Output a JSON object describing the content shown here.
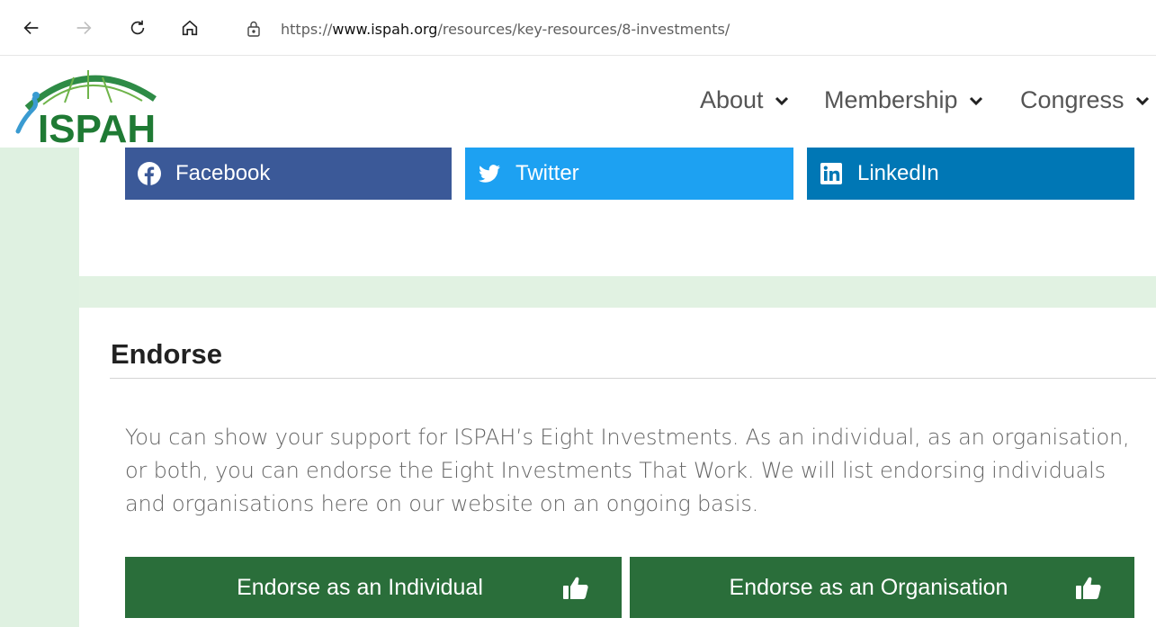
{
  "browser": {
    "url_prefix": "https://",
    "url_host": "www.ispah.org",
    "url_path": "/resources/key-resources/8-investments/"
  },
  "header": {
    "logo_text": "ISPAH",
    "menu": [
      {
        "label": "About"
      },
      {
        "label": "Membership"
      },
      {
        "label": "Congress"
      }
    ]
  },
  "share": {
    "facebook": "Facebook",
    "twitter": "Twitter",
    "linkedin": "LinkedIn"
  },
  "endorse": {
    "title": "Endorse",
    "text": "You can show your support for ISPAH’s Eight Investments. As an individual, as an organisation, or both, you can endorse the Eight Investments That Work. We will list endorsing individuals and organisations here on our website on an ongoing basis.",
    "individual_label": "Endorse as an Individual",
    "organisation_label": "Endorse as an Organisation"
  },
  "colors": {
    "facebook": "#3b5998",
    "twitter": "#1da1f2",
    "linkedin": "#0077b5",
    "endorse_button": "#2a6e3a",
    "page_background": "#e1f2e2"
  }
}
